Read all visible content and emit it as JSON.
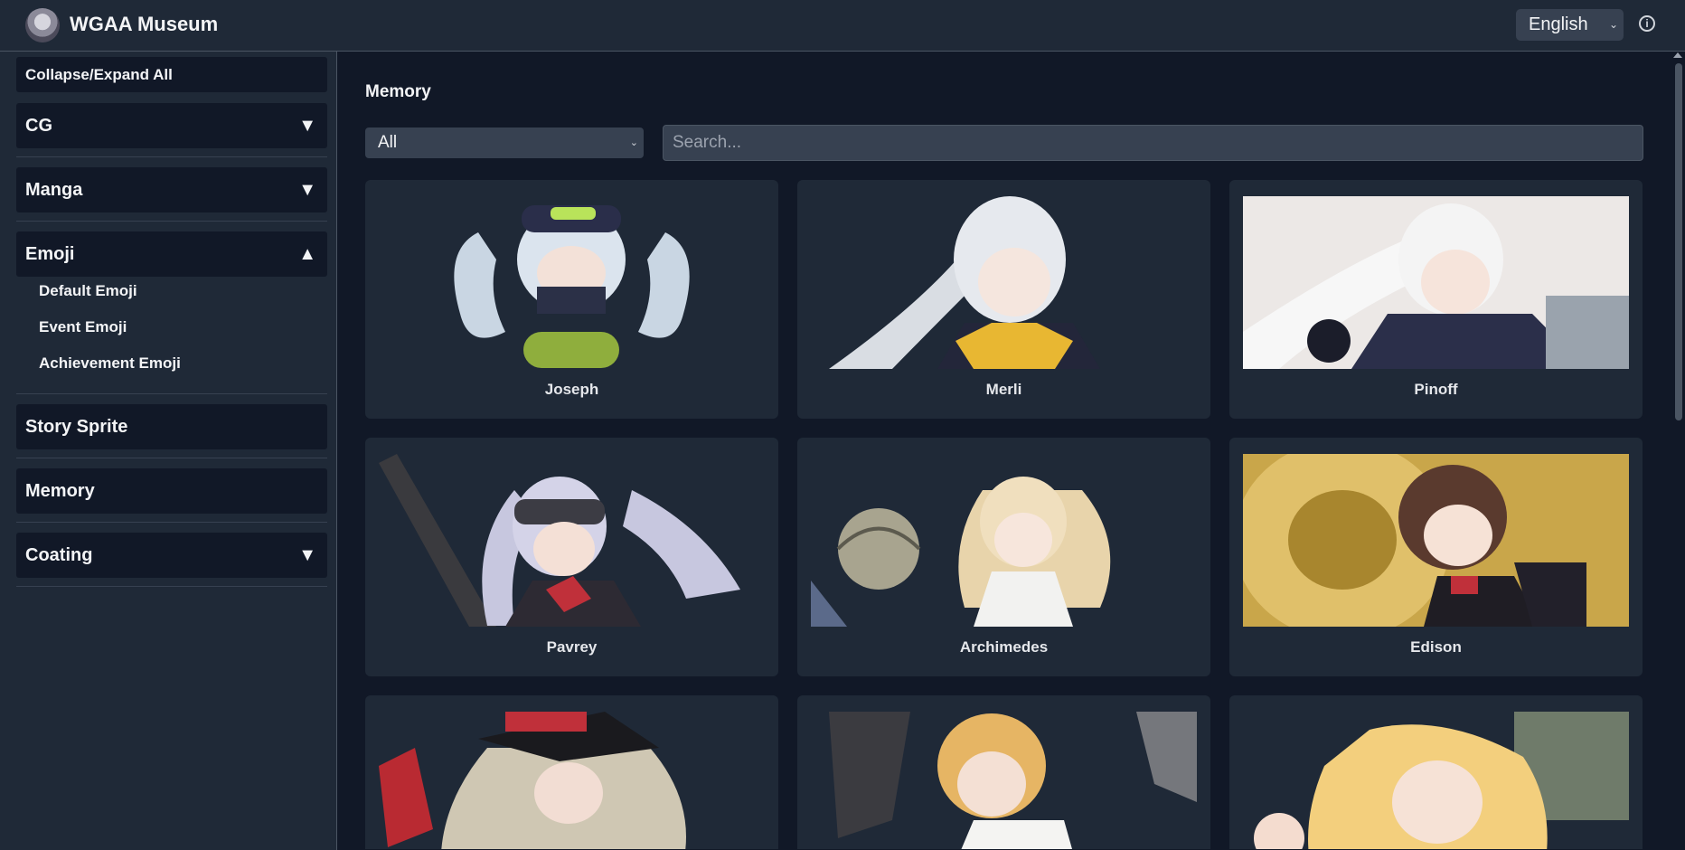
{
  "header": {
    "title": "WGAA Museum",
    "language": "English",
    "info_icon": "info-icon"
  },
  "sidebar": {
    "collapse_label": "Collapse/Expand All",
    "sections": [
      {
        "label": "CG",
        "caret": "▼"
      },
      {
        "label": "Manga",
        "caret": "▼"
      },
      {
        "label": "Emoji",
        "caret": "▲",
        "items": [
          "Default Emoji",
          "Event Emoji",
          "Achievement Emoji"
        ]
      },
      {
        "label": "Story Sprite"
      },
      {
        "label": "Memory"
      },
      {
        "label": "Coating",
        "caret": "▼"
      }
    ]
  },
  "main": {
    "title": "Memory",
    "filter_value": "All",
    "search_placeholder": "Search...",
    "cards": [
      "Joseph",
      "Merli",
      "Pinoff",
      "Pavrey",
      "Archimedes",
      "Edison"
    ],
    "partial_cards": 3
  },
  "colors": {
    "background": "#111827",
    "panel": "#1f2937",
    "input": "#374151",
    "text": "#f3f4f6"
  }
}
